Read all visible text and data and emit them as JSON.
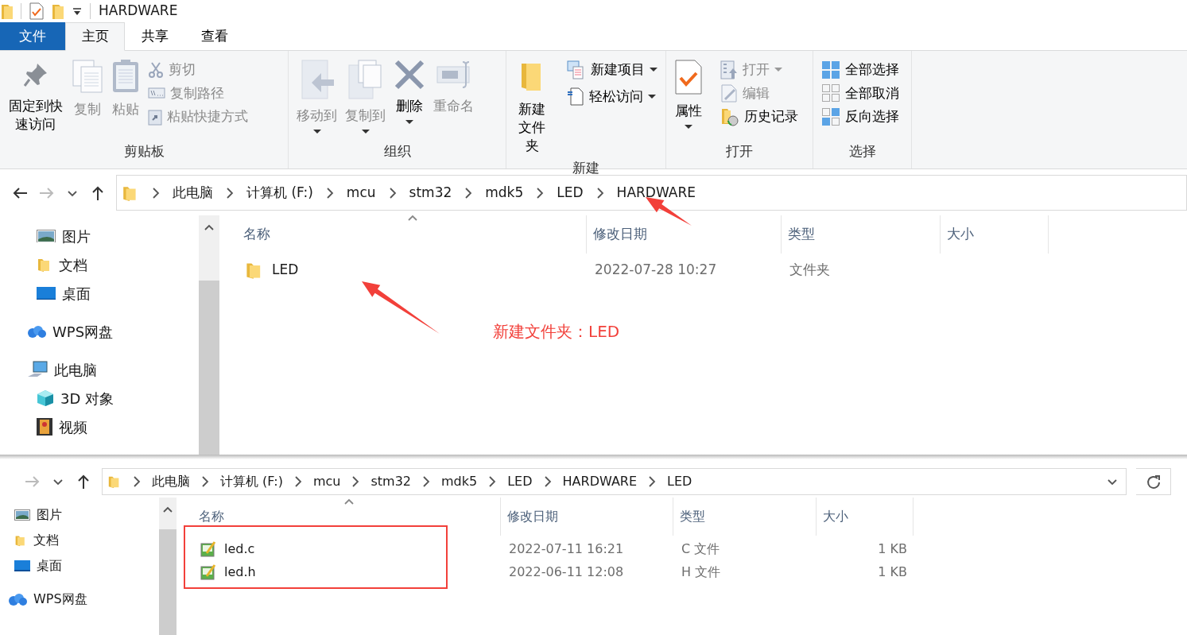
{
  "windows": [
    {
      "title": "HARDWARE",
      "file_tab": "文件",
      "tabs": [
        {
          "label": "主页",
          "selected": true
        },
        {
          "label": "共享",
          "selected": false
        },
        {
          "label": "查看",
          "selected": false
        }
      ],
      "ribbon": [
        {
          "label": "剪贴板",
          "items": [
            {
              "kind": "large",
              "label": "固定到快速访问",
              "disabled": false,
              "dropdown": false
            },
            {
              "kind": "large",
              "label": "复制",
              "disabled": true,
              "dropdown": false
            },
            {
              "kind": "large",
              "label": "粘贴",
              "disabled": true,
              "dropdown": false
            },
            {
              "kind": "stack",
              "items": [
                {
                  "label": "剪切",
                  "disabled": true,
                  "dropdown": false
                },
                {
                  "label": "复制路径",
                  "disabled": true,
                  "dropdown": false
                },
                {
                  "label": "粘贴快捷方式",
                  "disabled": true,
                  "dropdown": false
                }
              ]
            }
          ]
        },
        {
          "label": "组织",
          "items": [
            {
              "kind": "large",
              "label": "移动到",
              "disabled": true,
              "dropdown": true
            },
            {
              "kind": "large",
              "label": "复制到",
              "disabled": true,
              "dropdown": true
            },
            {
              "kind": "large",
              "label": "删除",
              "disabled": false,
              "dropdown": true
            },
            {
              "kind": "large",
              "label": "重命名",
              "disabled": true,
              "dropdown": false
            }
          ]
        },
        {
          "label": "新建",
          "items": [
            {
              "kind": "large",
              "label": "新建文件夹",
              "disabled": false,
              "dropdown": false
            },
            {
              "kind": "stack",
              "items": [
                {
                  "label": "新建项目",
                  "disabled": false,
                  "dropdown": true
                },
                {
                  "label": "轻松访问",
                  "disabled": false,
                  "dropdown": true
                }
              ]
            }
          ]
        },
        {
          "label": "打开",
          "items": [
            {
              "kind": "large",
              "label": "属性",
              "disabled": false,
              "dropdown": true
            },
            {
              "kind": "stack",
              "items": [
                {
                  "label": "打开",
                  "disabled": true,
                  "dropdown": true
                },
                {
                  "label": "编辑",
                  "disabled": true,
                  "dropdown": false
                },
                {
                  "label": "历史记录",
                  "disabled": false,
                  "dropdown": false
                }
              ]
            }
          ]
        },
        {
          "label": "选择",
          "items": [
            {
              "kind": "stack",
              "items": [
                {
                  "label": "全部选择",
                  "disabled": false,
                  "dropdown": false
                },
                {
                  "label": "全部取消",
                  "disabled": false,
                  "dropdown": false
                },
                {
                  "label": "反向选择",
                  "disabled": false,
                  "dropdown": false
                }
              ]
            }
          ]
        }
      ],
      "back_enabled": true,
      "forward_enabled": false,
      "address": [
        "此电脑",
        "计算机 (F:)",
        "mcu",
        "stm32",
        "mdk5",
        "LED",
        "HARDWARE"
      ],
      "nav_pane": [
        {
          "label": "图片"
        },
        {
          "label": "文档"
        },
        {
          "label": "桌面"
        },
        {
          "label": "WPS网盘",
          "kind": "root"
        },
        {
          "label": "此电脑",
          "kind": "root",
          "children": [
            {
              "label": "3D 对象"
            },
            {
              "label": "视频"
            }
          ]
        }
      ],
      "columns": [
        "名称",
        "修改日期",
        "类型",
        "大小"
      ],
      "rows": [
        {
          "kind": "folder",
          "cells": [
            "LED",
            "2022-07-28 10:27",
            "文件夹"
          ]
        }
      ]
    },
    {
      "forward_enabled": false,
      "address": [
        "此电脑",
        "计算机 (F:)",
        "mcu",
        "stm32",
        "mdk5",
        "LED",
        "HARDWARE",
        "LED"
      ],
      "nav_pane": [
        {
          "label": "图片"
        },
        {
          "label": "文档"
        },
        {
          "label": "桌面"
        },
        {
          "label": "WPS网盘",
          "kind": "root"
        }
      ],
      "columns": [
        "名称",
        "修改日期",
        "类型",
        "大小"
      ],
      "rows": [
        {
          "kind": "file",
          "cells": [
            "led.c",
            "2022-07-11 16:21",
            "C 文件",
            "1 KB"
          ]
        },
        {
          "kind": "file",
          "cells": [
            "led.h",
            "2022-06-11 12:08",
            "H 文件",
            "1 KB"
          ]
        }
      ]
    }
  ],
  "annotations": [
    {
      "kind": "arrow"
    },
    {
      "kind": "arrow"
    },
    {
      "kind": "text",
      "text": "新建文件夹：LED"
    },
    {
      "kind": "frame"
    }
  ]
}
